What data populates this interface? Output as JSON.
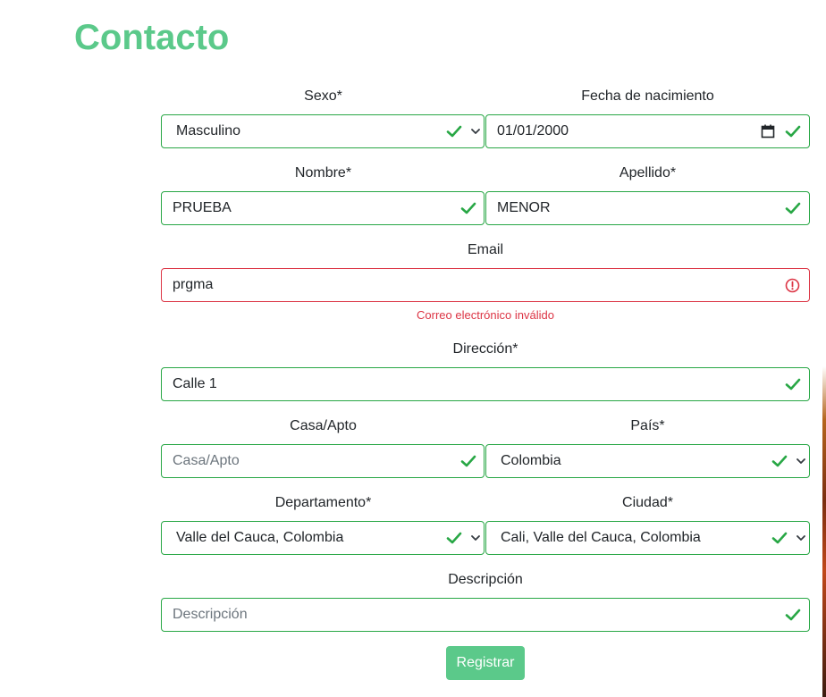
{
  "page": {
    "title": "Contacto"
  },
  "form": {
    "sexo": {
      "label": "Sexo*",
      "value": "Masculino"
    },
    "fecha": {
      "label": "Fecha de nacimiento",
      "value": "01/01/2000"
    },
    "nombre": {
      "label": "Nombre*",
      "value": "PRUEBA"
    },
    "apellido": {
      "label": "Apellido*",
      "value": "MENOR"
    },
    "email": {
      "label": "Email",
      "value": "prgma",
      "error": "Correo electrónico inválido"
    },
    "direccion": {
      "label": "Dirección*",
      "value": "Calle 1"
    },
    "casa": {
      "label": "Casa/Apto",
      "value": "",
      "placeholder": "Casa/Apto"
    },
    "pais": {
      "label": "País*",
      "value": "Colombia"
    },
    "departamento": {
      "label": "Departamento*",
      "value": "Valle del Cauca, Colombia"
    },
    "ciudad": {
      "label": "Ciudad*",
      "value": "Cali, Valle del Cauca, Colombia"
    },
    "descripcion": {
      "label": "Descripción",
      "value": "",
      "placeholder": "Descripción"
    },
    "submit_label": "Registrar"
  },
  "colors": {
    "accent": "#5bc98a",
    "valid": "#28a745",
    "invalid": "#dc3545"
  },
  "icons": {
    "valid": "check-icon",
    "invalid": "exclamation-circle-icon",
    "dropdown": "chevron-down-icon",
    "date": "calendar-icon"
  }
}
